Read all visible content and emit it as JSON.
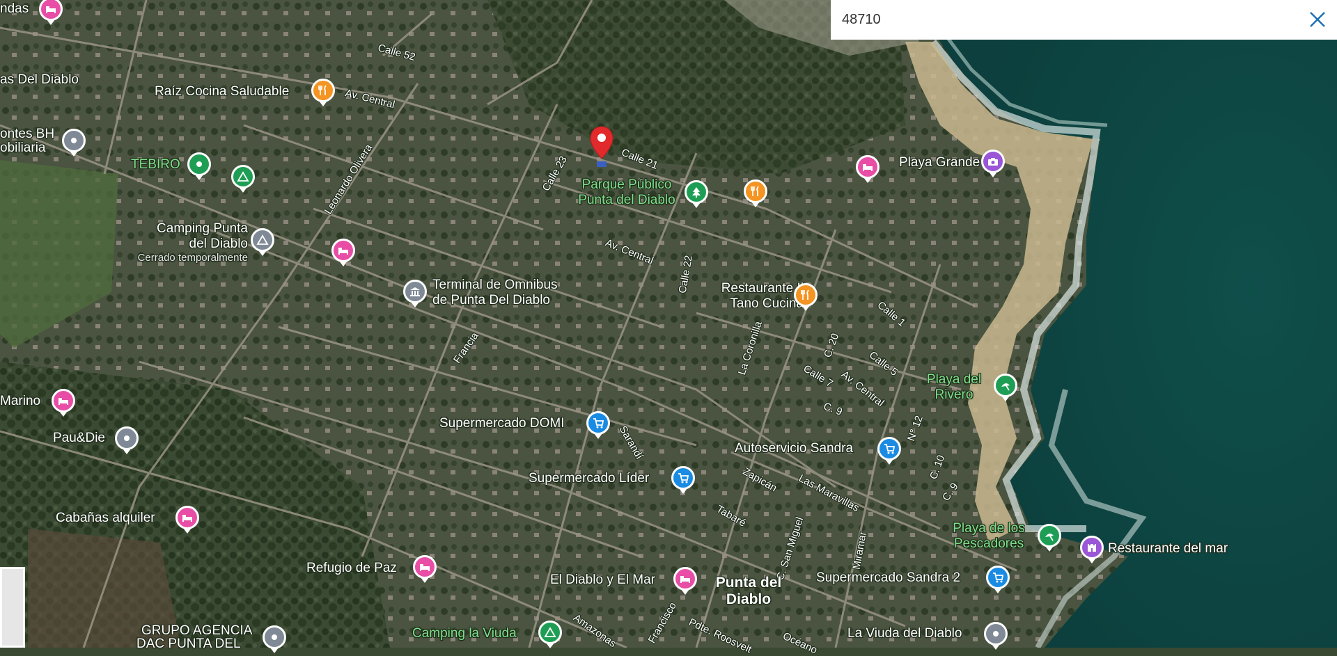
{
  "search": {
    "value": "48710"
  },
  "colors": {
    "lodging": "#e84ea6",
    "restaurant": "#f39423",
    "park": "#1e9e55",
    "shopping": "#1a8be3",
    "generic": "#7f8a96",
    "tourism": "#9a56d6",
    "beach": "#1e9e55",
    "camping": "#1e9e55",
    "selected_pin": "#e2292b"
  },
  "places": {
    "cabanas_top": {
      "label": "ndas",
      "icon": "bed-icon"
    },
    "las_del_diablo": {
      "label": "as Del Diablo"
    },
    "raiz": {
      "label": "Raíz Cocina Saludable",
      "icon": "fork-knife-icon"
    },
    "montes": {
      "label1": "ontes BH",
      "label2": "obiliaria",
      "icon": "pin-dot-icon"
    },
    "tebiro": {
      "label": "TEBIRO",
      "icon": "pin-dot-icon"
    },
    "tebiro_camp": {
      "icon": "tent-icon"
    },
    "camping_pd": {
      "label1": "Camping Punta",
      "label2": "del Diablo",
      "label3": "Cerrado temporalmente",
      "icon": "tent-icon"
    },
    "lodging_1": {
      "icon": "bed-icon"
    },
    "terminal": {
      "label1": "Terminal de Omnibus",
      "label2": "de Punta Del Diablo",
      "icon": "landmark-icon"
    },
    "parque": {
      "label1": "Parque Público",
      "label2": "Punta del Diablo",
      "icon": "tree-icon"
    },
    "restaurant_2": {
      "icon": "fork-knife-icon"
    },
    "playa_grande": {
      "label": "Playa Grande",
      "icon": "camera-icon"
    },
    "playa_grande_lodge": {
      "icon": "bed-icon"
    },
    "il_tano": {
      "label1": "Restaurante Il",
      "label2": "Tano Cucina",
      "icon": "fork-knife-icon"
    },
    "marino": {
      "label": "Marino",
      "icon": "bed-icon"
    },
    "pau_die": {
      "label": "Pau&Die",
      "icon": "pin-dot-icon"
    },
    "domi": {
      "label": "Supermercado DOMI",
      "icon": "cart-icon"
    },
    "lider": {
      "label": "Supermercado Líder",
      "icon": "cart-icon"
    },
    "sandra_auto": {
      "label": "Autoservicio Sandra",
      "icon": "cart-icon"
    },
    "rivero": {
      "label1": "Playa del",
      "label2": "Rivero",
      "icon": "beach-icon"
    },
    "cabanas_alquiler": {
      "label": "Cabañas alquiler",
      "icon": "bed-icon"
    },
    "refugio": {
      "label": "Refugio de Paz",
      "icon": "bed-icon"
    },
    "pescadores": {
      "label1": "Playa de los",
      "label2": "Pescadores",
      "icon": "beach-icon"
    },
    "rest_mar": {
      "label": "Restaurante del mar",
      "icon": "castle-icon"
    },
    "diablo_mar": {
      "label": "El Diablo y El Mar",
      "icon": "bed-icon"
    },
    "pd_town": {
      "label1": "Punta del",
      "label2": "Diablo"
    },
    "sandra2": {
      "label": "Supermercado Sandra 2",
      "icon": "cart-icon"
    },
    "grupo": {
      "label1": "GRUPO AGENCIA",
      "label2": "DAC PUNTA DEL",
      "icon": "pin-dot-icon"
    },
    "camping_viuda": {
      "label": "Camping la Viuda",
      "icon": "tent-icon"
    },
    "viuda_diablo": {
      "label": "La Viuda del Diablo",
      "icon": "pin-dot-icon"
    }
  },
  "streets": {
    "calle52": "Calle 52",
    "av_central_1": "Av. Central",
    "leonardo": "Leonardo Olivera",
    "calle23": "Calle 23",
    "calle21": "Calle 21",
    "av_central_2": "Av. Central",
    "calle22": "Calle 22",
    "francia": "Francia",
    "calle1": "Calle 1",
    "la_coronilla": "La Coronilla",
    "c20": "C. 20",
    "calle5": "Calle 5",
    "calle7": "Calle 7",
    "av_central_3": "Av. Central",
    "c9a": "C. 9",
    "n12": "N° 12",
    "c10": "C. 10",
    "c9b": "C. 9",
    "sarandi": "Sarandí",
    "zapican": "Zapicán",
    "las_maravillas": "Las Maravillas",
    "tabare": "Tabaré",
    "san_miguel": "C. San Miguel",
    "miramar": "Miramar",
    "amazonas": "Amazonas",
    "francisco": "Francisco",
    "roosevelt": "Pdte. Roosvelt",
    "oceano": "Océano"
  }
}
